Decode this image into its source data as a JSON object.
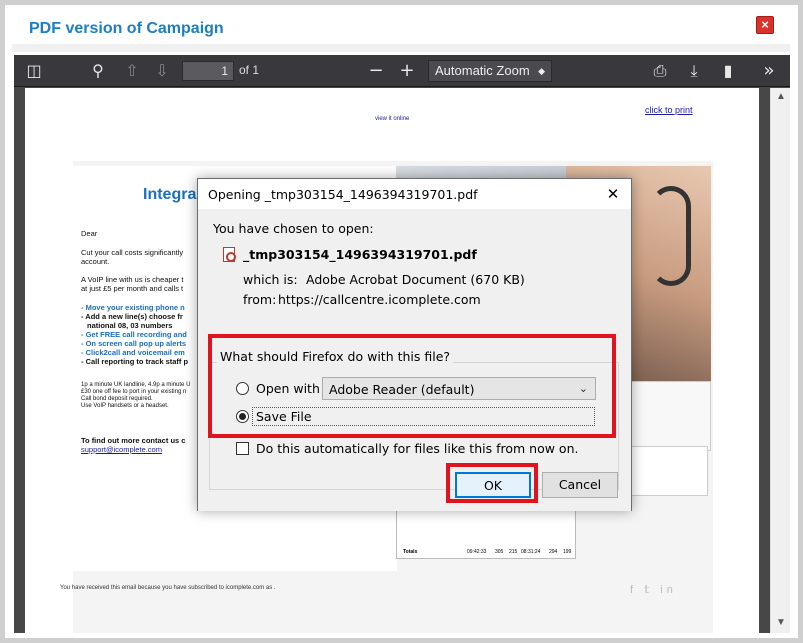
{
  "modal": {
    "title": "PDF version of Campaign",
    "close_glyph": "×"
  },
  "viewer": {
    "current_page": "1",
    "page_of": "of 1",
    "zoom": "Automatic Zoom"
  },
  "email": {
    "click_to_print": "click to print",
    "view_online": "view it online",
    "heading": "Integra",
    "greeting": "Dear",
    "p1": "Cut your call costs significantly",
    "p1b": "account.",
    "p2": "A VoIP line with us is cheaper t",
    "p2b": "at just £5 per month and calls t",
    "bullets": [
      "- Move your existing phone n",
      "- Add a new line(s) choose fr",
      "national 08, 03 numbers",
      "- Get FREE call recording and",
      "- On screen call pop up alerts",
      "- Click2call and voicemail em",
      "- Call reporting to track staff p"
    ],
    "fine_print": [
      "1p a minute UK landline, 4.9p a minute U",
      "£30 one off fee to port in your existing n",
      "Call bond deposit required.",
      "Use VoIP handsets or a headset."
    ],
    "contact": "To find out more contact us c",
    "support_email": "support@icomplete.com",
    "footer": "You have received this email because you have subscribed to icomplete.com as .",
    "table_total_label": "Totals",
    "table_total_values": [
      "09:42:33",
      "305",
      "215",
      "08:31:24",
      "294",
      "199"
    ]
  },
  "dialog": {
    "title": "Opening _tmp303154_1496394319701.pdf",
    "close_glyph": "✕",
    "intro": "You have chosen to open:",
    "filename": "_tmp303154_1496394319701.pdf",
    "which_is_label": "which is:",
    "which_is_value": "Adobe Acrobat Document (670 KB)",
    "from_label": "from:",
    "from_value": "https://callcentre.icomplete.com",
    "question": "What should Firefox do with this file?",
    "open_with_label": "Open with",
    "open_with_app": "Adobe Reader  (default)",
    "save_file_label": "Save File",
    "auto_label": "Do this automatically for files like this from now on.",
    "ok_label": "OK",
    "cancel_label": "Cancel",
    "selected_option": "save_file"
  },
  "colors": {
    "highlight": "#e0141e",
    "title_blue": "#1a7fc7",
    "toolbar": "#38383d"
  }
}
